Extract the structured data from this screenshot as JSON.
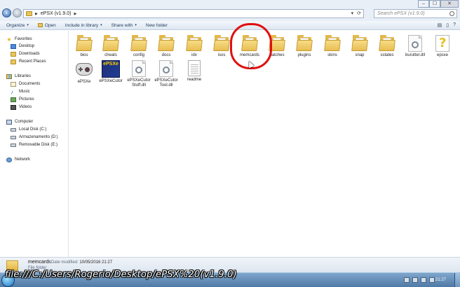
{
  "window": {
    "controls": [
      "–",
      "☐",
      "✕"
    ]
  },
  "address": {
    "path_folder": "ePSX (v1.9.0)",
    "search_placeholder": "Search ePSX (v1.9.0)"
  },
  "toolbar": {
    "organize": "Organize",
    "open": "Open",
    "include_in_library": "Include in library",
    "share_with": "Share with",
    "new_folder": "New folder"
  },
  "sidebar": {
    "favorites": "Favorites",
    "desktop": "Desktop",
    "downloads": "Downloads",
    "recent_places": "Recent Places",
    "libraries": "Libraries",
    "documents": "Documents",
    "music": "Music",
    "pictures": "Pictures",
    "videos": "Videos",
    "computer": "Computer",
    "local_disk": "Local Disk (C:)",
    "armazenamento": "Armazenamento (D:)",
    "removable_disk": "Removable Disk (E:)",
    "network": "Network"
  },
  "files": {
    "bios": "bios",
    "cheats": "cheats",
    "config": "config",
    "docs": "docs",
    "idx": "idx",
    "isos": "isos",
    "memcards": "memcards",
    "patches": "patches",
    "plugins": "plugins",
    "skins": "skins",
    "snap": "snap",
    "sstates": "sstates",
    "burutter_dll": "burutter.dll",
    "epsxe_cfg": "epsxe",
    "epsxe_exe": "ePSXe",
    "epsxecutor": "ePSXeCutor",
    "epsxecutor_stuff": "ePSXeCutor Stuff.dll",
    "epsxecutor_tool": "ePSXeCutor Tool.dll",
    "readme": "readme",
    "logo_text": "ePSXe"
  },
  "details": {
    "name": "memcards",
    "date_label": "Date modified:",
    "date_value": "10/05/2016 21:27",
    "type": "File folder"
  },
  "overlay": {
    "path": "file:///C:/Users/Rogerio/Desktop/ePSX%20(v1.9.0)"
  },
  "taskbar": {
    "clock": "21:27"
  }
}
